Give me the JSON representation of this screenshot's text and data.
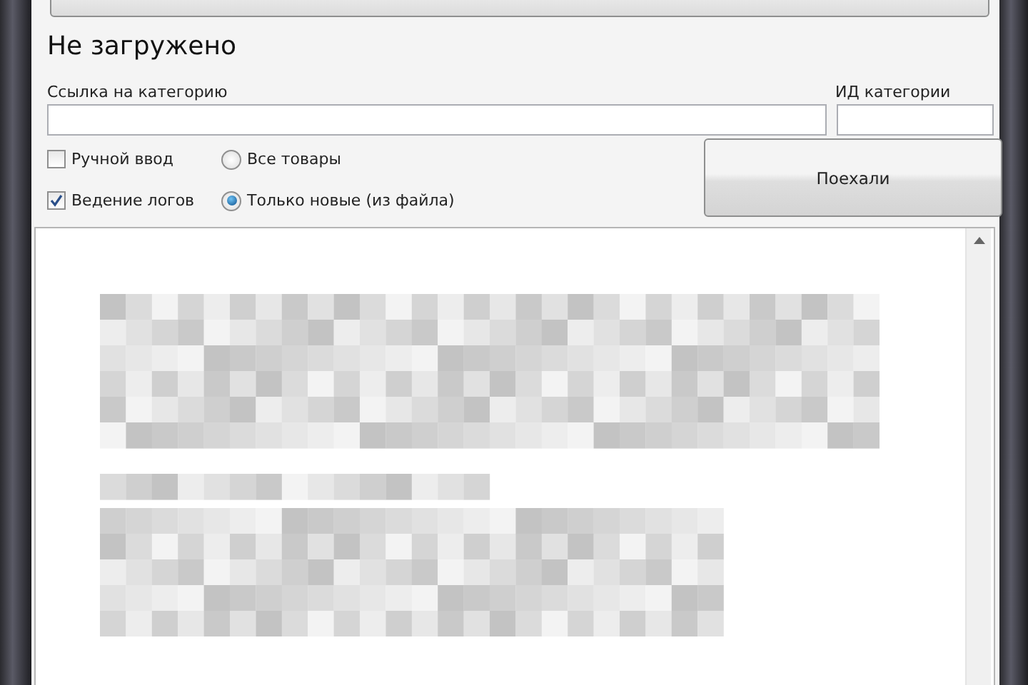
{
  "status": "Не загружено",
  "fields": [
    {
      "label": "Ссылка на категорию"
    },
    {
      "label": "ИД категории"
    }
  ],
  "checkboxes": [
    {
      "label": "Ручной ввод",
      "checked": false
    },
    {
      "label": "Ведение логов",
      "checked": true
    }
  ],
  "radios": [
    {
      "label": "Все товары",
      "selected": false
    },
    {
      "label": "Только новые (из файла)",
      "selected": true
    }
  ],
  "go_button": "Поехали"
}
